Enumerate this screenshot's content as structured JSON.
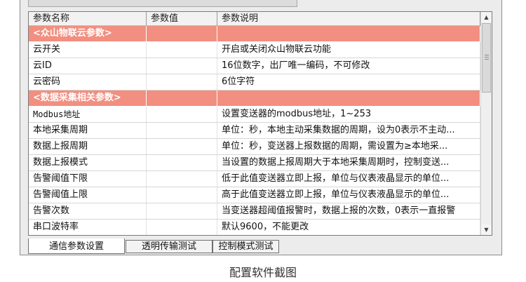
{
  "header": {
    "col_name": "参数名称",
    "col_value": "参数值",
    "col_desc": "参数说明"
  },
  "rows": [
    {
      "type": "section",
      "name": "<众山物联云参数>",
      "value": "",
      "desc": ""
    },
    {
      "type": "row",
      "name": "云开关",
      "value": "",
      "desc": "开启或关闭众山物联云功能"
    },
    {
      "type": "row",
      "name": "云ID",
      "value": "",
      "desc": "16位数字，出厂唯一编码，不可修改"
    },
    {
      "type": "row",
      "name": "云密码",
      "value": "",
      "desc": "6位字符"
    },
    {
      "type": "section",
      "name": "<数据采集相关参数>",
      "value": "",
      "desc": ""
    },
    {
      "type": "row",
      "name": "Modbus地址",
      "value": "",
      "desc": "设置变送器的modbus地址，1~253"
    },
    {
      "type": "row",
      "name": "本地采集周期",
      "value": "",
      "desc": "单位：秒，本地主动采集数据的周期，设为0表示不主动..."
    },
    {
      "type": "row",
      "name": "数据上报周期",
      "value": "",
      "desc": "单位：秒，变送器上报数据的周期，需设置为≥本地采..."
    },
    {
      "type": "row",
      "name": "数据上报模式",
      "value": "",
      "desc": "当设置的数据上报周期大于本地采集周期时，控制变送..."
    },
    {
      "type": "row",
      "name": "告警阈值下限",
      "value": "",
      "desc": "低于此值变送器立即上报，单位与仪表液晶显示的单位..."
    },
    {
      "type": "row",
      "name": "告警阈值上限",
      "value": "",
      "desc": "高于此值变送器立即上报，单位与仪表液晶显示的单位..."
    },
    {
      "type": "row",
      "name": "告警次数",
      "value": "",
      "desc": "当变送器超阈值报警时，数据上报的次数，0表示一直报警"
    },
    {
      "type": "row",
      "name": "串口波特率",
      "value": "",
      "desc": "默认9600，不能更改"
    }
  ],
  "tabs": [
    {
      "label": "通信参数设置",
      "active": true
    },
    {
      "label": "透明传输测试",
      "active": false
    },
    {
      "label": "控制模式测试",
      "active": false
    }
  ],
  "caption": "配置软件截图",
  "colors": {
    "section_bg": "#f28f80",
    "section_text": "#ffffff"
  },
  "icons": {
    "scroll_up": "triangle-up-icon",
    "scroll_down": "triangle-down-icon"
  }
}
